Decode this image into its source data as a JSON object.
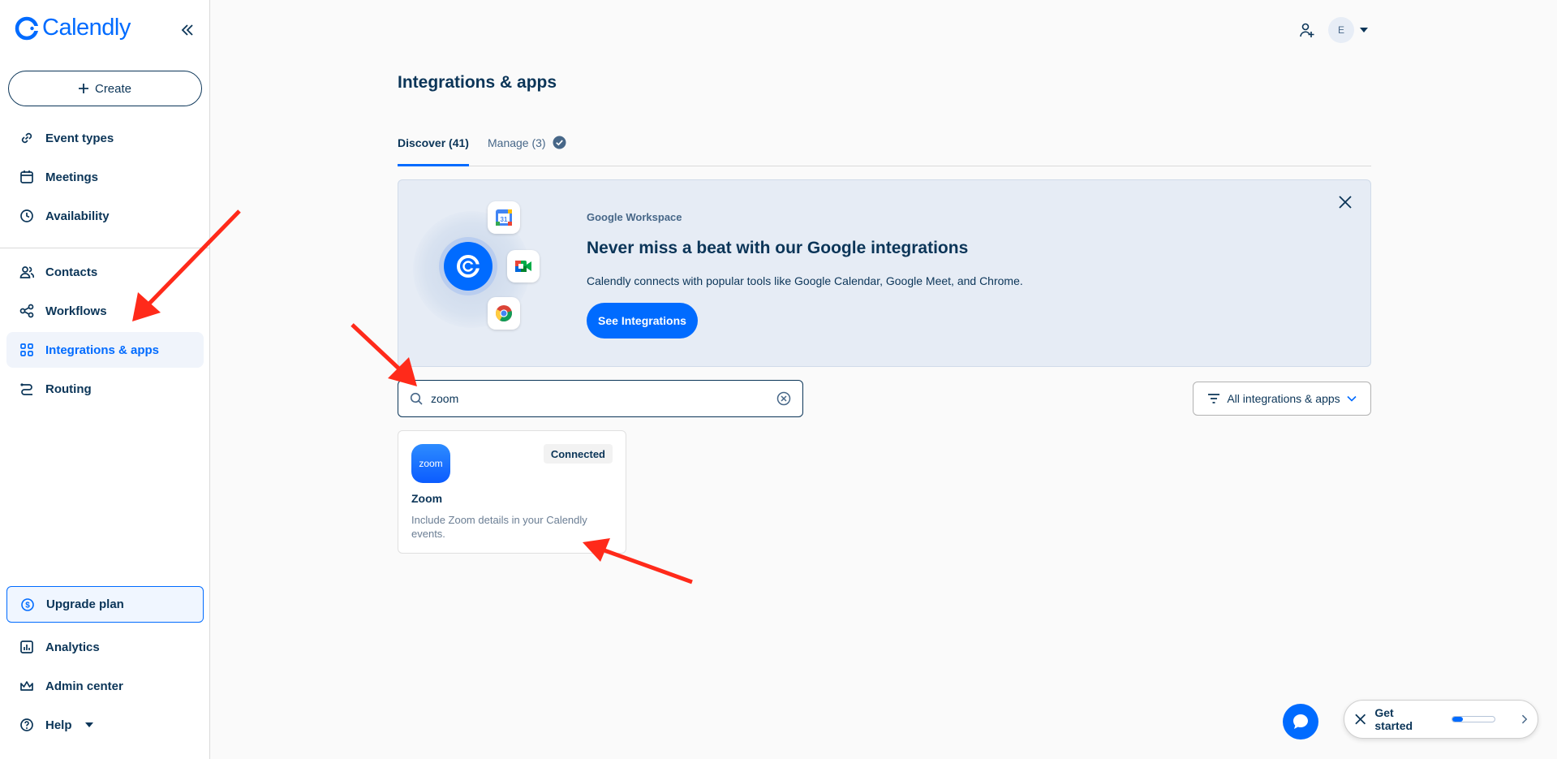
{
  "brand": {
    "name": "Calendly",
    "color": "#006bff"
  },
  "sidebar": {
    "create_label": "Create",
    "items": [
      {
        "label": "Event types",
        "icon": "link-icon"
      },
      {
        "label": "Meetings",
        "icon": "calendar-icon"
      },
      {
        "label": "Availability",
        "icon": "clock-icon"
      },
      {
        "label": "Contacts",
        "icon": "contacts-icon"
      },
      {
        "label": "Workflows",
        "icon": "workflow-icon"
      },
      {
        "label": "Integrations & apps",
        "icon": "grid-icon",
        "active": true
      },
      {
        "label": "Routing",
        "icon": "routing-icon"
      }
    ],
    "upgrade_label": "Upgrade plan",
    "bottom_items": [
      {
        "label": "Analytics",
        "icon": "chart-icon"
      },
      {
        "label": "Admin center",
        "icon": "crown-icon"
      },
      {
        "label": "Help",
        "icon": "help-icon"
      }
    ]
  },
  "header": {
    "avatar_initial": "E"
  },
  "main": {
    "title": "Integrations & apps",
    "tabs": [
      {
        "label": "Discover (41)",
        "active": true
      },
      {
        "label": "Manage (3)",
        "active": false
      }
    ],
    "banner": {
      "eyebrow": "Google Workspace",
      "title": "Never miss a beat with our Google integrations",
      "description": "Calendly connects with popular tools like Google Calendar, Google Meet, and Chrome.",
      "button_label": "See Integrations",
      "calendar_icon_text": "31"
    },
    "search": {
      "value": "zoom",
      "placeholder": "Search"
    },
    "filter_label": "All integrations & apps",
    "results": [
      {
        "name": "Zoom",
        "logo_text": "zoom",
        "badge": "Connected",
        "description": "Include Zoom details in your Calendly events."
      }
    ]
  },
  "footer": {
    "get_started_label": "Get started",
    "get_started_progress": 0.25
  },
  "colors": {
    "primary": "#006bff",
    "text": "#0b3558",
    "annotation": "#ff2a1a"
  }
}
